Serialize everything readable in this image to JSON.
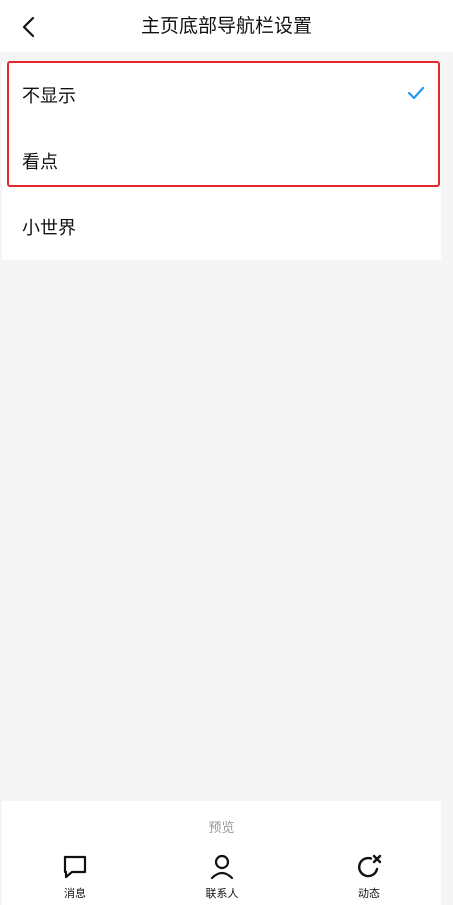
{
  "header": {
    "title": "主页底部导航栏设置",
    "back_icon": "chevron-left-icon"
  },
  "options": [
    {
      "label": "不显示",
      "selected": true
    },
    {
      "label": "看点",
      "selected": false
    },
    {
      "label": "小世界",
      "selected": false
    }
  ],
  "colors": {
    "accent": "#1a9bf0",
    "highlight_border": "#e5262c",
    "background": "#f5f5f5"
  },
  "preview": {
    "label": "预览",
    "tabs": [
      {
        "label": "消息",
        "icon": "chat-bubble-icon"
      },
      {
        "label": "联系人",
        "icon": "person-icon"
      },
      {
        "label": "动态",
        "icon": "refresh-star-icon"
      }
    ]
  }
}
